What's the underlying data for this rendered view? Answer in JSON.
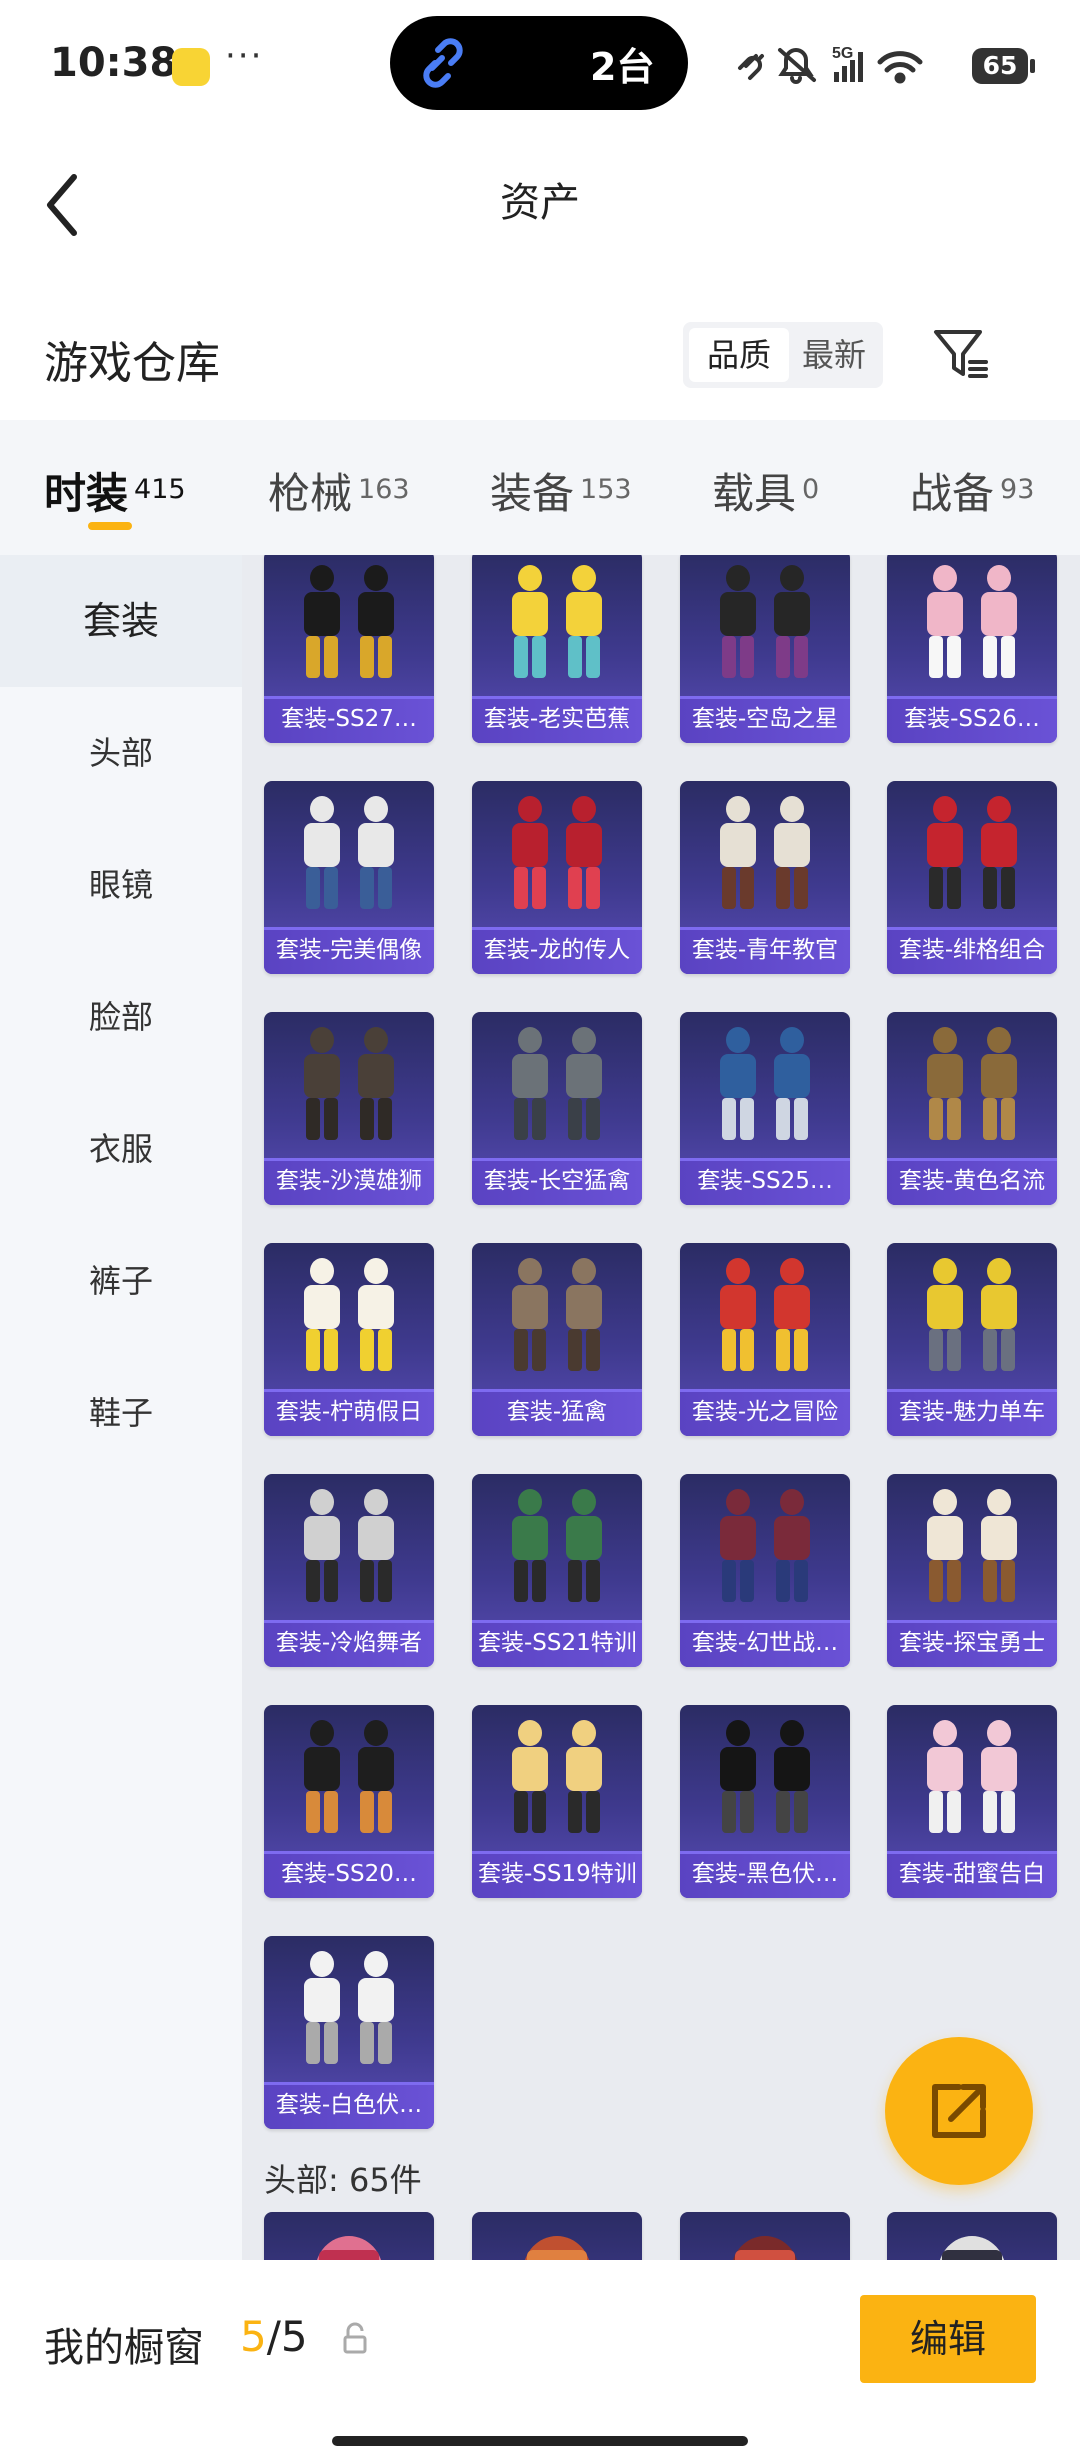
{
  "status_bar": {
    "time": "10:38",
    "more": "···",
    "island_text": "2台",
    "battery": "65"
  },
  "nav": {
    "title": "资产"
  },
  "section": {
    "title": "游戏仓库",
    "sort_quality": "品质",
    "sort_latest": "最新"
  },
  "tabs": [
    {
      "label": "时装",
      "count": "415"
    },
    {
      "label": "枪械",
      "count": "163"
    },
    {
      "label": "装备",
      "count": "153"
    },
    {
      "label": "载具",
      "count": "0"
    },
    {
      "label": "战备",
      "count": "93"
    }
  ],
  "sidebar": [
    "套装",
    "头部",
    "眼镜",
    "脸部",
    "衣服",
    "裤子",
    "鞋子"
  ],
  "items": [
    "套装-SS27…",
    "套装-老实芭蕉",
    "套装-空岛之星",
    "套装-SS26…",
    "套装-完美偶像",
    "套装-龙的传人",
    "套装-青年教官",
    "套装-绯格组合",
    "套装-沙漠雄狮",
    "套装-长空猛禽",
    "套装-SS25…",
    "套装-黄色名流",
    "套装-柠萌假日",
    "套装-猛禽",
    "套装-光之冒险",
    "套装-魅力单车",
    "套装-冷焰舞者",
    "套装-SS21特训",
    "套装-幻世战…",
    "套装-探宝勇士",
    "套装-SS20…",
    "套装-SS19特训",
    "套装-黑色伏…",
    "套装-甜蜜告白",
    "套装-白色伏…"
  ],
  "head_section": {
    "label": "头部: 65件"
  },
  "footer": {
    "label": "我的橱窗",
    "current": "5",
    "sep": "/",
    "total": "5",
    "edit": "编辑"
  },
  "colors": {
    "accent": "#fbb312",
    "card_bg": "#3f3a8f",
    "label_bg": "#6a52d6"
  }
}
